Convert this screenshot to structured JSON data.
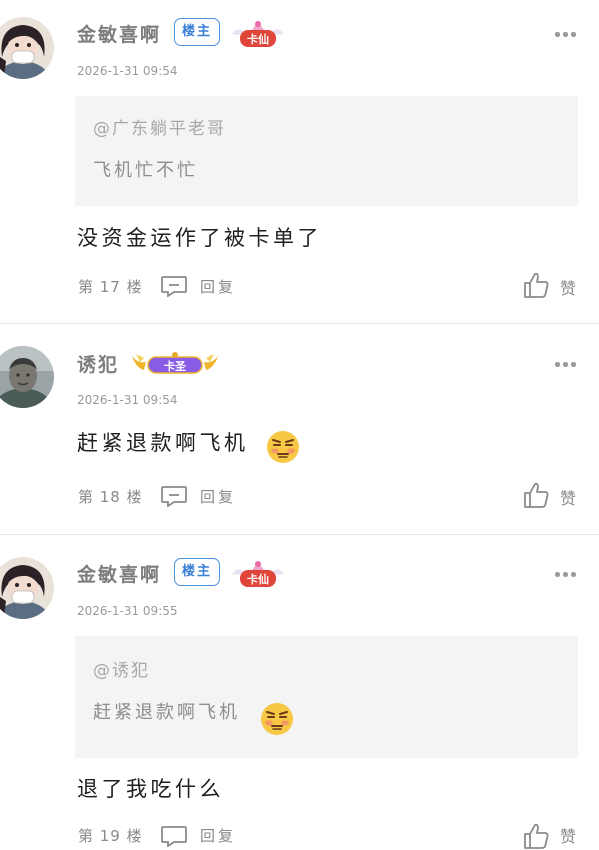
{
  "posts": [
    {
      "author": "金敏喜啊",
      "owner_badge": "楼主",
      "rank_badge": "卡仙",
      "time": "2026-1-31 09:54",
      "quote": {
        "mention": "@广东躺平老哥",
        "text": "飞机忙不忙"
      },
      "content": "没资金运作了被卡单了",
      "floor": "第 17 楼",
      "reply_label": "回复",
      "like_label": "赞"
    },
    {
      "author": "诱犯",
      "rank_badge": "卡圣",
      "time": "2026-1-31 09:54",
      "content": "赶紧退款啊飞机",
      "content_emoji": "cringe-face-emoji",
      "floor": "第 18 楼",
      "reply_label": "回复",
      "like_label": "赞"
    },
    {
      "author": "金敏喜啊",
      "owner_badge": "楼主",
      "rank_badge": "卡仙",
      "time": "2026-1-31 09:55",
      "quote": {
        "mention": "@诱犯",
        "text": "赶紧退款啊飞机",
        "emoji": "cringe-face-emoji"
      },
      "content": "退了我吃什么",
      "floor": "第 19 楼",
      "reply_label": "回复",
      "like_label": "赞"
    }
  ],
  "colors": {
    "owner_badge": "#4a8fe0",
    "kaxian_badge": "#e0453a",
    "kasheng_badge": "#8a5ce6",
    "quote_bg": "#f4f4f4",
    "divider": "#e6e6e6"
  }
}
